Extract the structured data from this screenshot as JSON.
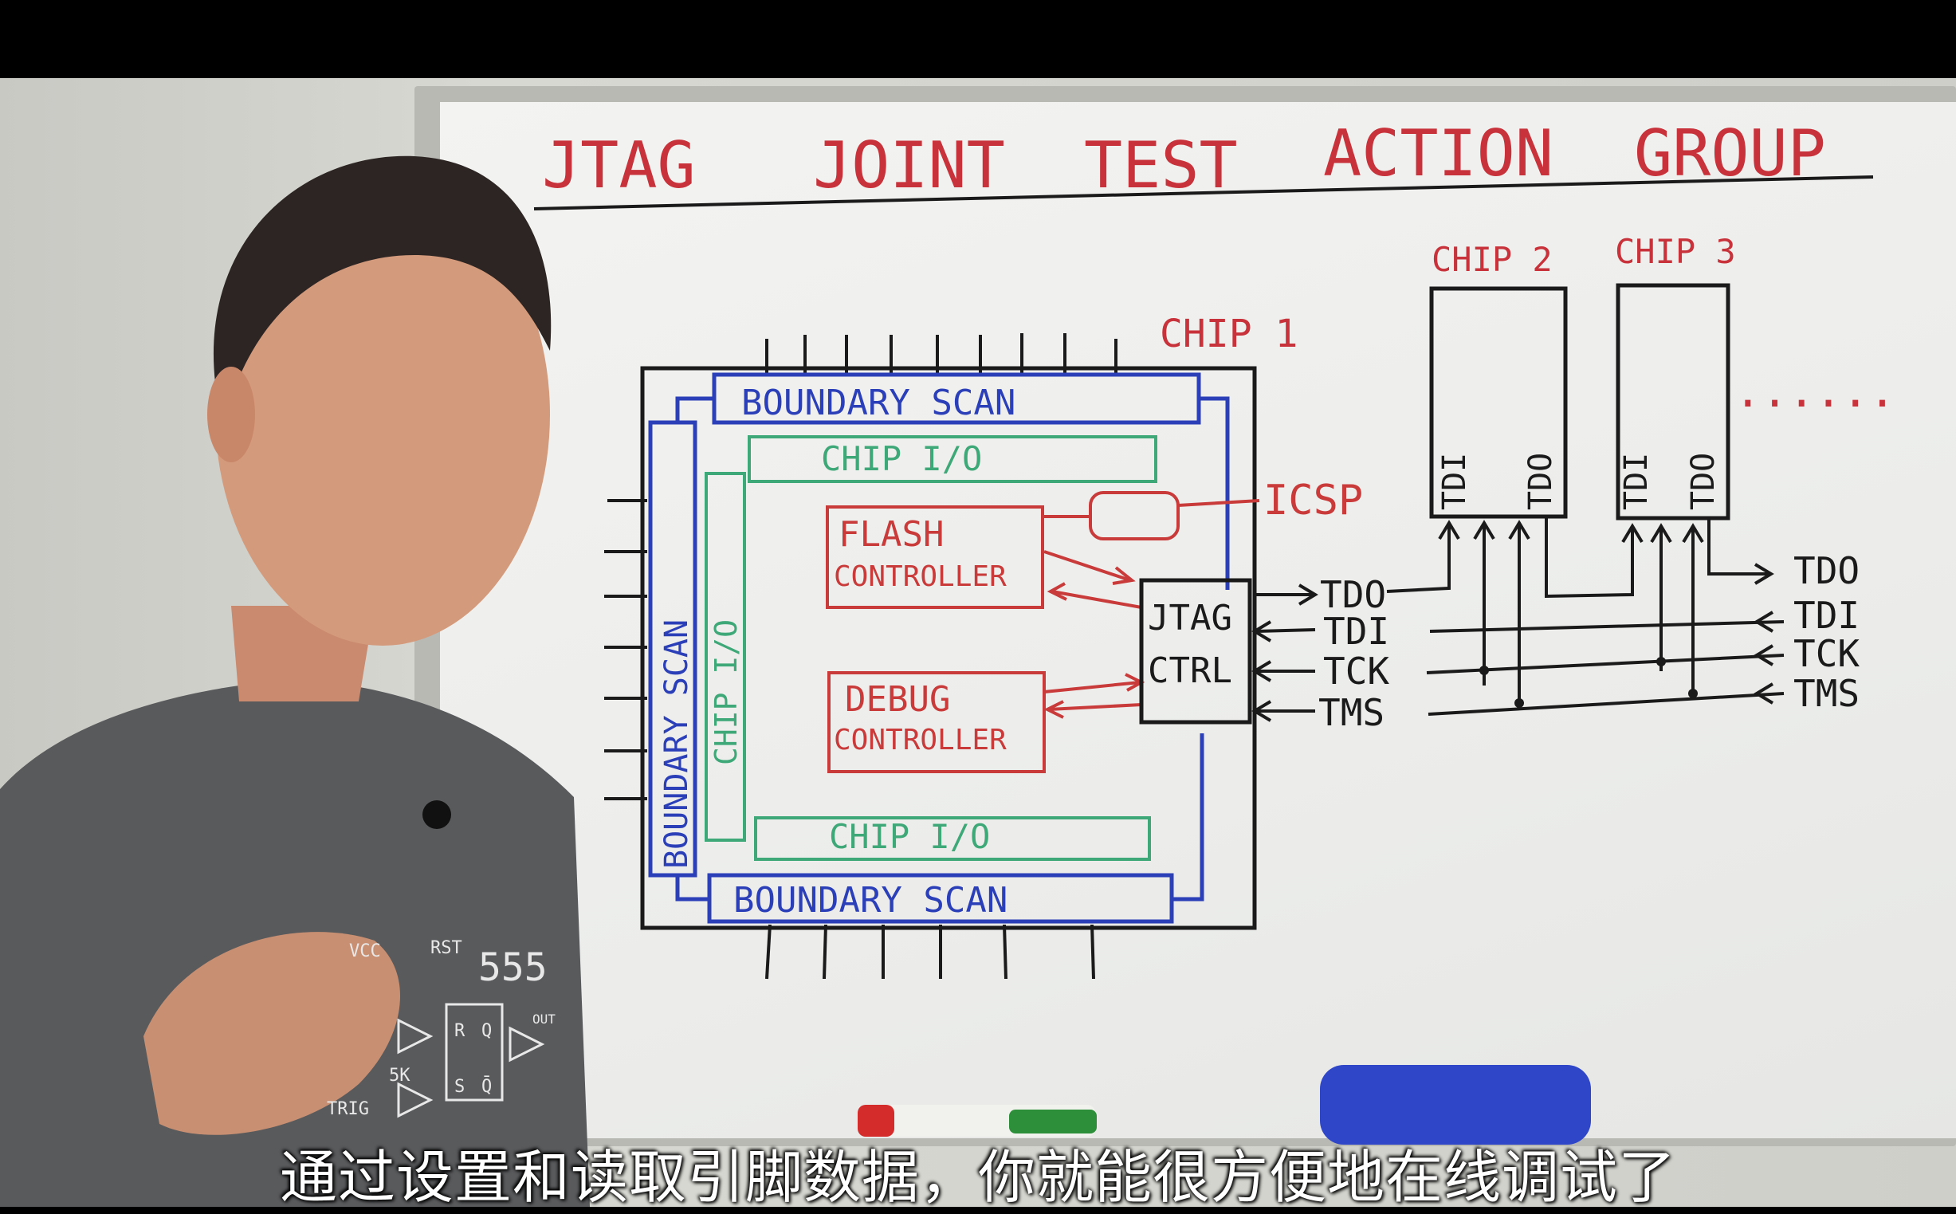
{
  "board": {
    "title": {
      "jtag": "JTAG",
      "joint": "JOINT",
      "test": "TEST",
      "action": "ACTION",
      "group": "GROUP"
    },
    "chip1": {
      "label": "CHIP 1",
      "boundary_scan_top": "BOUNDARY SCAN",
      "boundary_scan_left": "BOUNDARY SCAN",
      "boundary_scan_bottom": "BOUNDARY SCAN",
      "chip_io_top": "CHIP I/O",
      "chip_io_left": "CHIP I/O",
      "chip_io_bottom": "CHIP I/O",
      "flash_controller": [
        "FLASH",
        "CONTROLLER"
      ],
      "debug_controller": [
        "DEBUG",
        "CONTROLLER"
      ],
      "jtag_ctrl": [
        "JTAG",
        "CTRL"
      ],
      "icsp": "ICSP"
    },
    "chip2": {
      "label": "CHIP 2",
      "tdi": "TDI",
      "tdo": "TDO"
    },
    "chip3": {
      "label": "CHIP 3",
      "tdi": "TDI",
      "tdo": "TDO"
    },
    "ellipsis": "......",
    "signals_left": [
      "TDO",
      "TDI",
      "TCK",
      "TMS"
    ],
    "signals_right": [
      "TDO",
      "TDI",
      "TCK",
      "TMS"
    ]
  },
  "shirt_print": {
    "vcc": "VCC",
    "rst": "RST",
    "chip": "555",
    "res": "5K",
    "trig": "TRIG",
    "r": "R",
    "q": "Q",
    "s": "S",
    "qbar": "Q̄",
    "out": "OUT"
  },
  "subtitle": "通过设置和读取引脚数据，你就能很方便地在线调试了",
  "colors": {
    "title_red": "#c8323a",
    "boundary_blue": "#2b3fb8",
    "chipio_green": "#3fa878",
    "controller_red": "#c93a3a",
    "ink_black": "#1a1a1a"
  }
}
